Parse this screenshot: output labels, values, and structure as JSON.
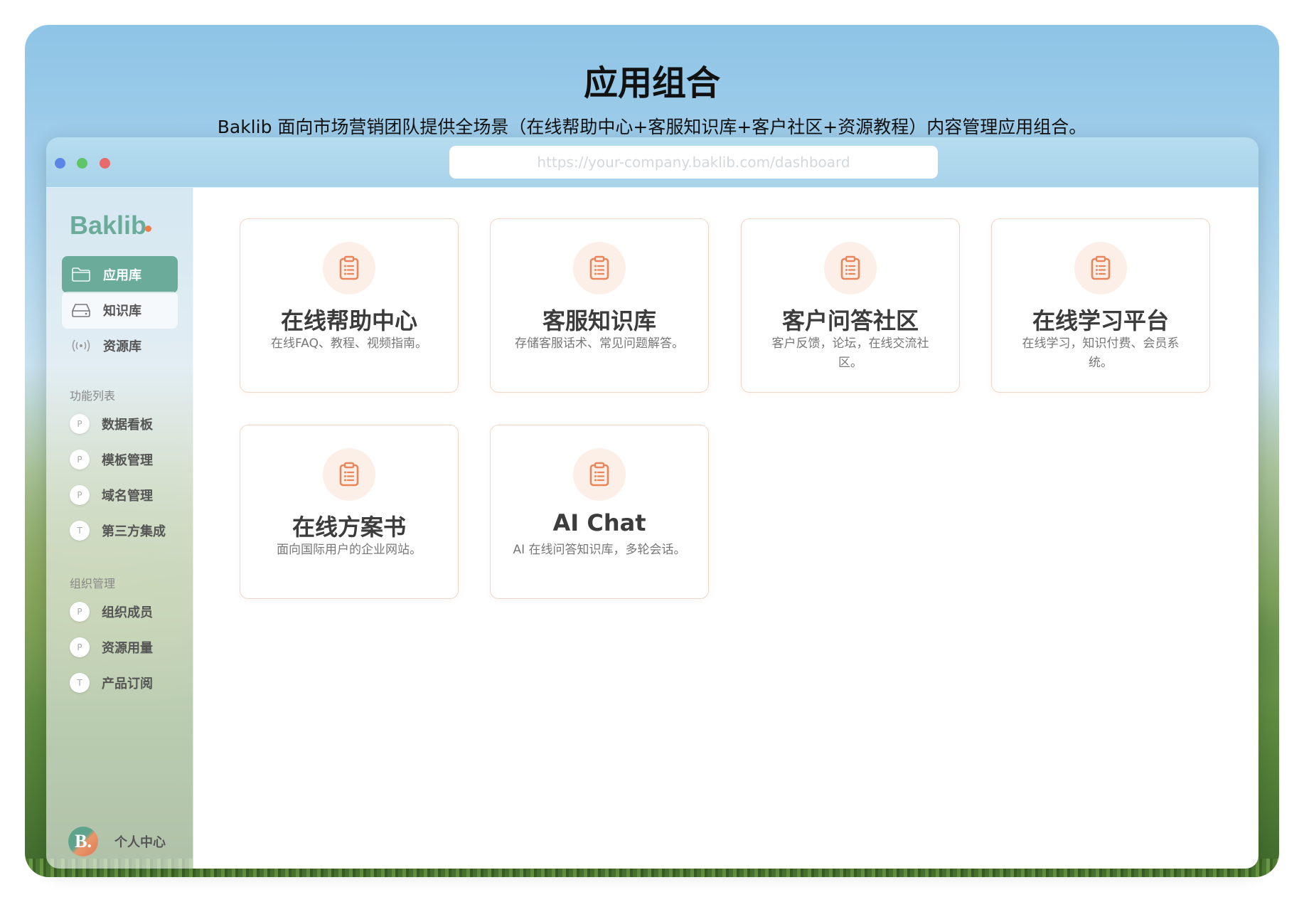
{
  "hero": {
    "title": "应用组合",
    "subtitle": "Baklib 面向市场营销团队提供全场景（在线帮助中心+客服知识库+客户社区+资源教程）内容管理应用组合。"
  },
  "browser": {
    "url_placeholder": "https://your-company.baklib.com/dashboard"
  },
  "sidebar": {
    "logo": "Baklib",
    "nav": [
      {
        "label": "应用库",
        "icon": "folder-icon"
      },
      {
        "label": "知识库",
        "icon": "drive-icon"
      },
      {
        "label": "资源库",
        "icon": "broadcast-icon"
      }
    ],
    "features_label": "功能列表",
    "features": [
      {
        "badge": "P",
        "label": "数据看板"
      },
      {
        "badge": "P",
        "label": "模板管理"
      },
      {
        "badge": "P",
        "label": "域名管理"
      },
      {
        "badge": "T",
        "label": "第三方集成"
      }
    ],
    "org_label": "组织管理",
    "org": [
      {
        "badge": "P",
        "label": "组织成员"
      },
      {
        "badge": "P",
        "label": "资源用量"
      },
      {
        "badge": "T",
        "label": "产品订阅"
      }
    ],
    "profile": {
      "avatar": "B.",
      "label": "个人中心"
    }
  },
  "cards": [
    {
      "title": "在线帮助中心",
      "desc": "在线FAQ、教程、视频指南。",
      "icon": "clipboard-icon"
    },
    {
      "title": "客服知识库",
      "desc": "存储客服话术、常见问题解答。",
      "icon": "clipboard-icon"
    },
    {
      "title": "客户问答社区",
      "desc": "客户反馈，论坛，在线交流社区。",
      "icon": "clipboard-icon"
    },
    {
      "title": "在线学习平台",
      "desc": "在线学习，知识付费、会员系统。",
      "icon": "clipboard-icon"
    },
    {
      "title": "在线方案书",
      "desc": "面向国际用户的企业网站。",
      "icon": "clipboard-icon"
    },
    {
      "title": "AI Chat",
      "desc": "AI 在线问答知识库，多轮会话。",
      "icon": "clipboard-icon"
    }
  ],
  "colors": {
    "accent": "#6aab9a",
    "logo_dot": "#ee7b4a",
    "card_icon": "#e9855a",
    "card_icon_bg": "#fcefe8",
    "card_border": "#f3d5c5"
  }
}
